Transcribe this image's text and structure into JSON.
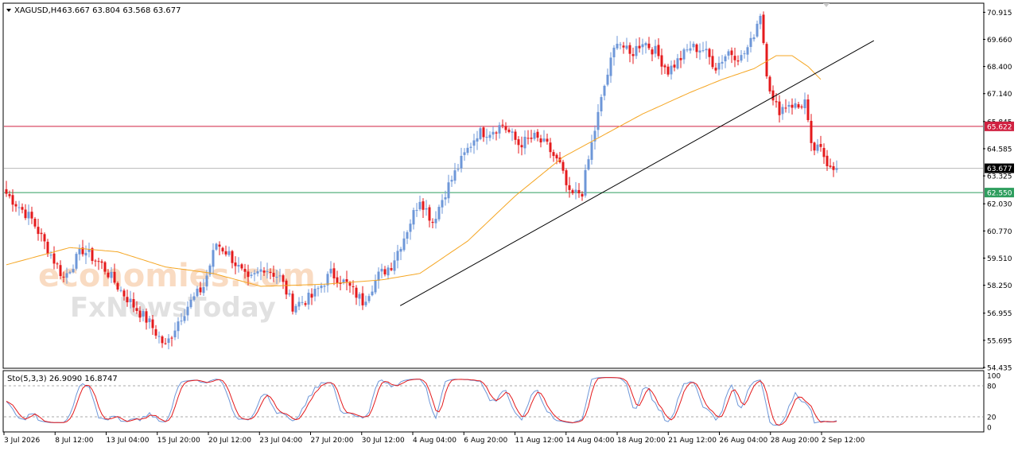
{
  "header": {
    "symbol": "XAGUSD,H4",
    "ohlc": "63.667 63.804 63.568 63.677"
  },
  "watermark": {
    "line1": "economies.com",
    "line2": "FxNewsToday"
  },
  "colors": {
    "bull": "#6e97d8",
    "bear": "#e41a1c",
    "ma": "#f5a623",
    "resistance": "#d02040",
    "support": "#2e9e5e",
    "price_line": "#b8b8b8",
    "current_bg": "#000000"
  },
  "chart_data": [
    {
      "type": "candlestick",
      "ylim": [
        54.435,
        71.3
      ],
      "y_ticks": [
        "70.915",
        "69.660",
        "68.400",
        "67.140",
        "65.845",
        "64.585",
        "63.325",
        "62.030",
        "60.770",
        "59.510",
        "58.250",
        "56.955",
        "55.695",
        "54.435"
      ],
      "x_ticks": [
        "3 Jul 2026",
        "8 Jul 12:00",
        "13 Jul 04:00",
        "15 Jul 20:00",
        "20 Jul 12:00",
        "23 Jul 04:00",
        "27 Jul 20:00",
        "30 Jul 12:00",
        "4 Aug 04:00",
        "6 Aug 20:00",
        "11 Aug 12:00",
        "14 Aug 04:00",
        "18 Aug 20:00",
        "21 Aug 12:00",
        "26 Aug 04:00",
        "28 Aug 20:00",
        "2 Sep 12:00"
      ],
      "bar_count": 205,
      "close_path": [
        [
          0,
          62.5
        ],
        [
          8,
          61.3
        ],
        [
          12,
          60.2
        ],
        [
          18,
          58.6
        ],
        [
          24,
          59.9
        ],
        [
          30,
          59.2
        ],
        [
          36,
          58.0
        ],
        [
          40,
          57.3
        ],
        [
          45,
          56.5
        ],
        [
          50,
          55.4
        ],
        [
          54,
          56.6
        ],
        [
          57,
          57.3
        ],
        [
          62,
          58.2
        ],
        [
          66,
          60.2
        ],
        [
          70,
          59.7
        ],
        [
          76,
          58.4
        ],
        [
          81,
          59.1
        ],
        [
          86,
          58.6
        ],
        [
          90,
          57.3
        ],
        [
          96,
          57.7
        ],
        [
          102,
          58.8
        ],
        [
          107,
          58.3
        ],
        [
          112,
          57.5
        ],
        [
          117,
          58.7
        ],
        [
          121,
          59.2
        ],
        [
          125,
          60.5
        ],
        [
          130,
          62.3
        ],
        [
          134,
          61.2
        ],
        [
          138,
          62.6
        ],
        [
          144,
          64.3
        ],
        [
          148,
          65.3
        ],
        [
          152,
          65.4
        ],
        [
          156,
          65.7
        ],
        [
          161,
          64.8
        ],
        [
          166,
          65.1
        ],
        [
          170,
          64.7
        ],
        [
          174,
          63.8
        ],
        [
          177,
          62.4
        ],
        [
          181,
          62.6
        ],
        [
          184,
          64.8
        ],
        [
          188,
          67.5
        ],
        [
          192,
          69.7
        ],
        [
          196,
          68.9
        ],
        [
          200,
          69.6
        ],
        [
          204,
          69.1
        ],
        [
          208,
          68.2
        ],
        [
          212,
          68.8
        ],
        [
          215,
          69.3
        ],
        [
          219,
          69.2
        ],
        [
          223,
          68.4
        ],
        [
          227,
          69.1
        ],
        [
          231,
          68.8
        ],
        [
          234,
          69.5
        ],
        [
          237,
          70.9
        ],
        [
          239,
          68.2
        ],
        [
          241,
          66.7
        ],
        [
          243,
          66.4
        ],
        [
          246,
          66.7
        ],
        [
          249,
          66.5
        ],
        [
          251,
          66.8
        ],
        [
          253,
          64.6
        ],
        [
          256,
          64.5
        ],
        [
          258,
          64.0
        ],
        [
          261,
          63.7
        ]
      ],
      "moving_average": [
        [
          0,
          59.2
        ],
        [
          20,
          60.0
        ],
        [
          35,
          59.8
        ],
        [
          50,
          59.1
        ],
        [
          65,
          58.8
        ],
        [
          80,
          58.2
        ],
        [
          100,
          58.3
        ],
        [
          118,
          58.5
        ],
        [
          130,
          58.8
        ],
        [
          145,
          60.3
        ],
        [
          160,
          62.4
        ],
        [
          175,
          64.2
        ],
        [
          185,
          65.0
        ],
        [
          200,
          66.2
        ],
        [
          215,
          67.2
        ],
        [
          225,
          67.8
        ],
        [
          235,
          68.3
        ],
        [
          242,
          68.9
        ],
        [
          247,
          68.9
        ],
        [
          252,
          68.4
        ],
        [
          256,
          67.8
        ]
      ],
      "trendline": [
        [
          123.8,
          57.3
        ],
        [
          272.7,
          69.6
        ]
      ],
      "levels": [
        {
          "label": "65.622",
          "value": 65.622,
          "kind": "resistance"
        },
        {
          "label": "62.550",
          "value": 62.55,
          "kind": "support"
        }
      ],
      "current_price": {
        "label": "63.677",
        "value": 63.677
      }
    },
    {
      "type": "line",
      "title": "Sto(5,3,3) 26.9090 16.8747",
      "ylim": [
        0,
        100
      ],
      "y_ticks": [
        "100",
        "80",
        "20",
        "0"
      ],
      "levels": [
        80,
        20
      ],
      "main_color": "#6e97d8",
      "signal_color": "#e41a1c"
    }
  ]
}
